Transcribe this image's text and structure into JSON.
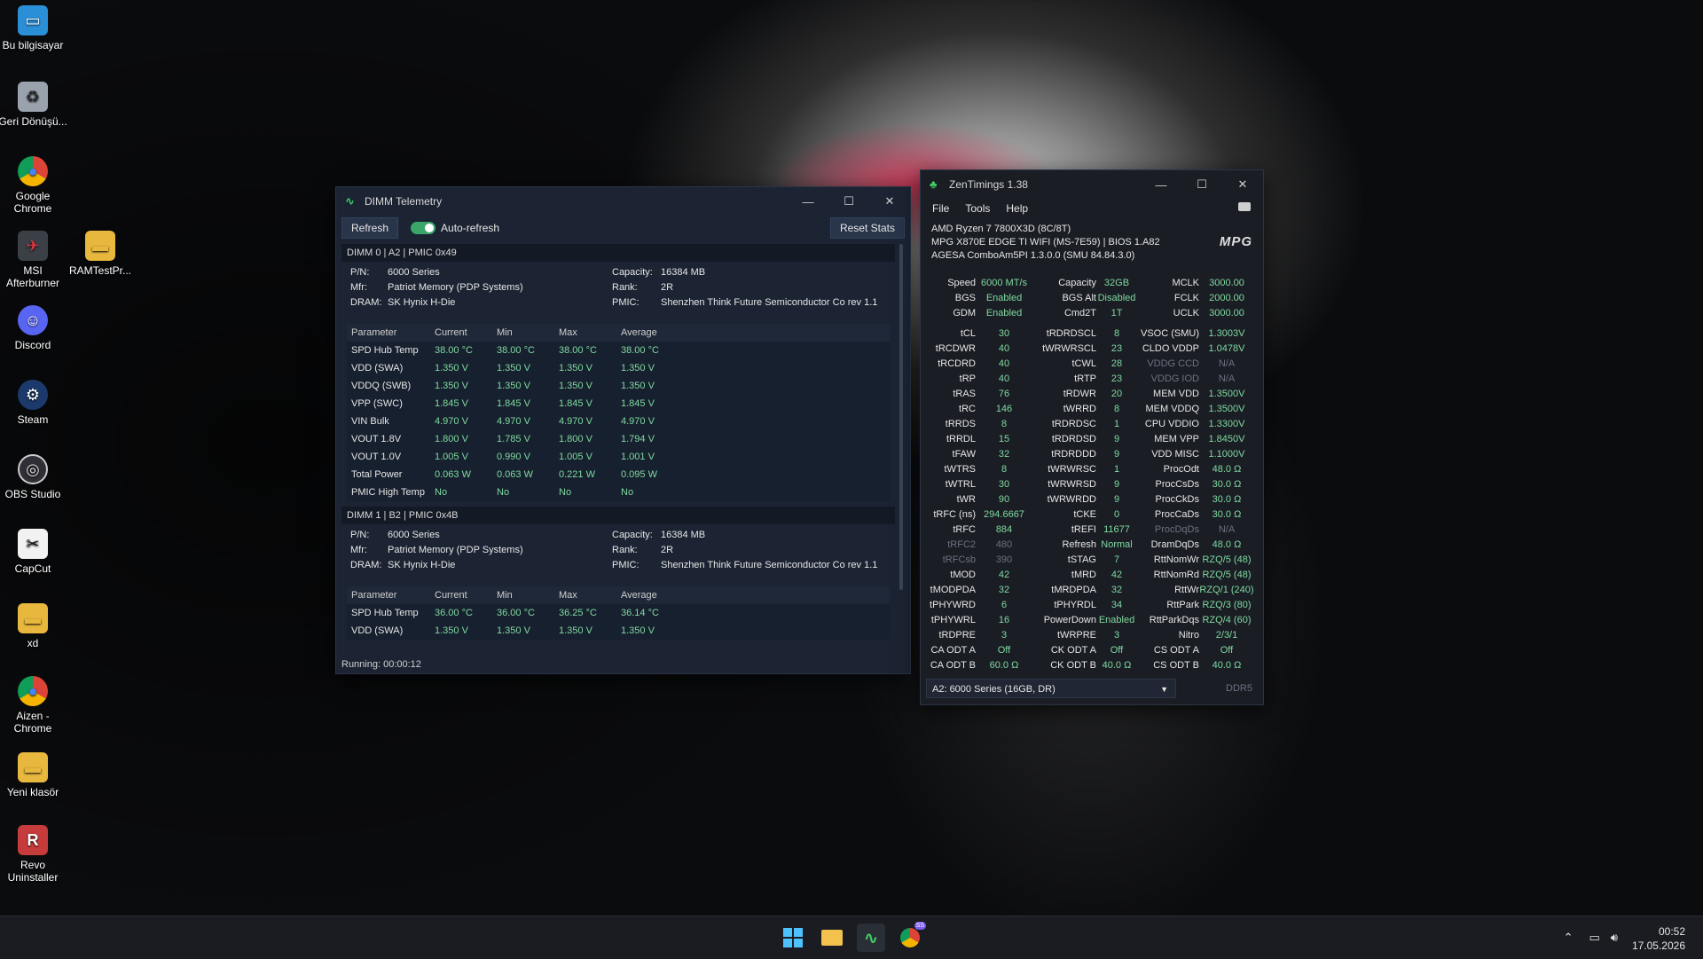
{
  "desktop": {
    "icons": [
      {
        "label": "Bu bilgisayar"
      },
      {
        "label": "Geri Dönüşü..."
      },
      {
        "label": "Google Chrome"
      },
      {
        "label": "MSI Afterburner"
      },
      {
        "label": "RAMTestPr..."
      },
      {
        "label": "Discord"
      },
      {
        "label": "Steam"
      },
      {
        "label": "OBS Studio"
      },
      {
        "label": "CapCut"
      },
      {
        "label": "xd"
      },
      {
        "label": "Aizen - Chrome"
      },
      {
        "label": "Yeni klasör"
      },
      {
        "label": "Revo Uninstaller"
      }
    ]
  },
  "dimm": {
    "title": "DIMM Telemetry",
    "refresh": "Refresh",
    "auto_refresh": "Auto-refresh",
    "reset": "Reset Stats",
    "status": "Running: 00:00:12",
    "headers": {
      "param": "Parameter",
      "current": "Current",
      "min": "Min",
      "max": "Max",
      "avg": "Average"
    },
    "labels": {
      "pn": "P/N:",
      "mfr": "Mfr:",
      "dram": "DRAM:",
      "cap": "Capacity:",
      "rank": "Rank:",
      "pmic": "PMIC:"
    },
    "modules": [
      {
        "header": "DIMM 0 | A2 | PMIC 0x49",
        "pn": "6000 Series",
        "mfr": "Patriot Memory (PDP Systems)",
        "dram": "SK Hynix H-Die",
        "capacity": "16384 MB",
        "rank": "2R",
        "pmic": "Shenzhen Think Future Semiconductor Co rev 1.1",
        "rows": [
          [
            "SPD Hub Temp",
            "38.00 °C",
            "38.00 °C",
            "38.00 °C",
            "38.00 °C"
          ],
          [
            "VDD (SWA)",
            "1.350 V",
            "1.350 V",
            "1.350 V",
            "1.350 V"
          ],
          [
            "VDDQ (SWB)",
            "1.350 V",
            "1.350 V",
            "1.350 V",
            "1.350 V"
          ],
          [
            "VPP (SWC)",
            "1.845 V",
            "1.845 V",
            "1.845 V",
            "1.845 V"
          ],
          [
            "VIN Bulk",
            "4.970 V",
            "4.970 V",
            "4.970 V",
            "4.970 V"
          ],
          [
            "VOUT 1.8V",
            "1.800 V",
            "1.785 V",
            "1.800 V",
            "1.794 V"
          ],
          [
            "VOUT 1.0V",
            "1.005 V",
            "0.990 V",
            "1.005 V",
            "1.001 V"
          ],
          [
            "Total Power",
            "0.063 W",
            "0.063 W",
            "0.221 W",
            "0.095 W"
          ],
          [
            "PMIC High Temp",
            "No",
            "No",
            "No",
            "No"
          ]
        ]
      },
      {
        "header": "DIMM 1 | B2 | PMIC 0x4B",
        "pn": "6000 Series",
        "mfr": "Patriot Memory (PDP Systems)",
        "dram": "SK Hynix H-Die",
        "capacity": "16384 MB",
        "rank": "2R",
        "pmic": "Shenzhen Think Future Semiconductor Co rev 1.1",
        "rows": [
          [
            "SPD Hub Temp",
            "36.00 °C",
            "36.00 °C",
            "36.25 °C",
            "36.14 °C"
          ],
          [
            "VDD (SWA)",
            "1.350 V",
            "1.350 V",
            "1.350 V",
            "1.350 V"
          ]
        ]
      }
    ]
  },
  "zen": {
    "title": "ZenTimings 1.38",
    "menu": [
      "File",
      "Tools",
      "Help"
    ],
    "cpu": "AMD Ryzen 7 7800X3D (8C/8T)",
    "board": "MPG X870E EDGE TI WIFI (MS-7E59) | BIOS 1.A82",
    "agesa": "AGESA ComboAm5PI 1.3.0.0 (SMU 84.84.3.0)",
    "logo": "MPG",
    "top_rows": [
      [
        "Speed",
        "6000 MT/s",
        "Capacity",
        "32GB",
        "MCLK",
        "3000.00"
      ],
      [
        "BGS",
        "Enabled",
        "BGS Alt",
        "Disabled",
        "FCLK",
        "2000.00"
      ],
      [
        "GDM",
        "Enabled",
        "Cmd2T",
        "1T",
        "UCLK",
        "3000.00"
      ]
    ],
    "rows": [
      [
        "tCL",
        "30",
        "tRDRDSCL",
        "8",
        "VSOC (SMU)",
        "1.3003V"
      ],
      [
        "tRCDWR",
        "40",
        "tWRWRSCL",
        "23",
        "CLDO VDDP",
        "1.0478V"
      ],
      [
        "tRCDRD",
        "40",
        "tCWL",
        "28",
        "VDDG CCD",
        "N/A"
      ],
      [
        "tRP",
        "40",
        "tRTP",
        "23",
        "VDDG IOD",
        "N/A"
      ],
      [
        "tRAS",
        "76",
        "tRDWR",
        "20",
        "MEM VDD",
        "1.3500V"
      ],
      [
        "tRC",
        "146",
        "tWRRD",
        "8",
        "MEM VDDQ",
        "1.3500V"
      ],
      [
        "tRRDS",
        "8",
        "tRDRDSC",
        "1",
        "CPU VDDIO",
        "1.3300V"
      ],
      [
        "tRRDL",
        "15",
        "tRDRDSD",
        "9",
        "MEM VPP",
        "1.8450V"
      ],
      [
        "tFAW",
        "32",
        "tRDRDDD",
        "9",
        "VDD MISC",
        "1.1000V"
      ],
      [
        "tWTRS",
        "8",
        "tWRWRSC",
        "1",
        "ProcOdt",
        "48.0 Ω"
      ],
      [
        "tWTRL",
        "30",
        "tWRWRSD",
        "9",
        "ProcCsDs",
        "30.0 Ω"
      ],
      [
        "tWR",
        "90",
        "tWRWRDD",
        "9",
        "ProcCkDs",
        "30.0 Ω"
      ],
      [
        "tRFC (ns)",
        "294.6667",
        "tCKE",
        "0",
        "ProcCaDs",
        "30.0 Ω"
      ],
      [
        "tRFC",
        "884",
        "tREFI",
        "11677",
        "ProcDqDs",
        "N/A"
      ],
      [
        "tRFC2",
        "480",
        "Refresh",
        "Normal",
        "DramDqDs",
        "48.0 Ω"
      ],
      [
        "tRFCsb",
        "390",
        "tSTAG",
        "7",
        "RttNomWr",
        "RZQ/5 (48)"
      ],
      [
        "tMOD",
        "42",
        "tMRD",
        "42",
        "RttNomRd",
        "RZQ/5 (48)"
      ],
      [
        "tMODPDA",
        "32",
        "tMRDPDA",
        "32",
        "RttWr",
        "RZQ/1 (240)"
      ],
      [
        "tPHYWRD",
        "6",
        "tPHYRDL",
        "34",
        "RttPark",
        "RZQ/3 (80)"
      ],
      [
        "tPHYWRL",
        "16",
        "PowerDown",
        "Enabled",
        "RttParkDqs",
        "RZQ/4 (60)"
      ],
      [
        "tRDPRE",
        "3",
        "tWRPRE",
        "3",
        "Nitro",
        "2/3/1"
      ],
      [
        "CA ODT A",
        "Off",
        "CK ODT A",
        "Off",
        "CS ODT A",
        "Off"
      ],
      [
        "CA ODT B",
        "60.0 Ω",
        "CK ODT B",
        "40.0 Ω",
        "CS ODT B",
        "40.0 Ω"
      ]
    ],
    "dimmed": [
      "VDDG CCD",
      "VDDG IOD",
      "tRFC2",
      "tRFCsb",
      "ProcDqDs"
    ],
    "selector": "A2: 6000 Series (16GB, DR)",
    "ddr": "DDR5"
  },
  "taskbar": {
    "time": "00:52",
    "date": "17.05.2026",
    "chrome_badge": "SS"
  },
  "colors": {
    "accent_green": "#7fd9a0",
    "window_bg": "#1c2433"
  }
}
